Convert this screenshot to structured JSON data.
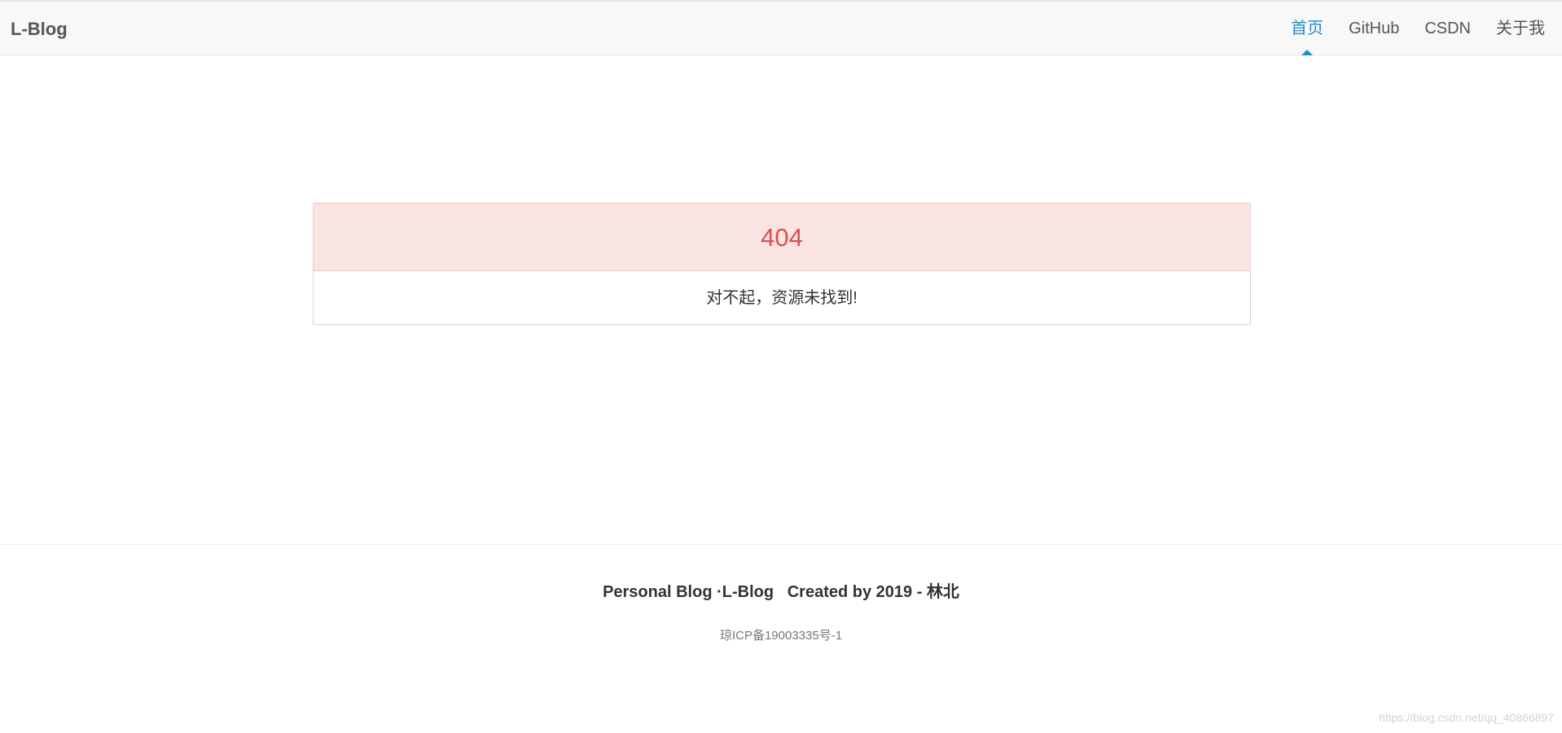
{
  "navbar": {
    "brand": "L-Blog",
    "items": [
      {
        "label": "首页",
        "active": true
      },
      {
        "label": "GitHub",
        "active": false
      },
      {
        "label": "CSDN",
        "active": false
      },
      {
        "label": "关于我",
        "active": false
      }
    ],
    "active_color": "#1a8ed0"
  },
  "error": {
    "code": "404",
    "message": "对不起，资源未找到!",
    "code_color": "#d9534f",
    "header_bg": "#f9e3e3"
  },
  "footer": {
    "line": "Personal Blog ·L-Blog   Created by 2019 - 林北",
    "icp": "琼ICP备19003335号-1"
  },
  "watermark": "https://blog.csdn.net/qq_40866897"
}
